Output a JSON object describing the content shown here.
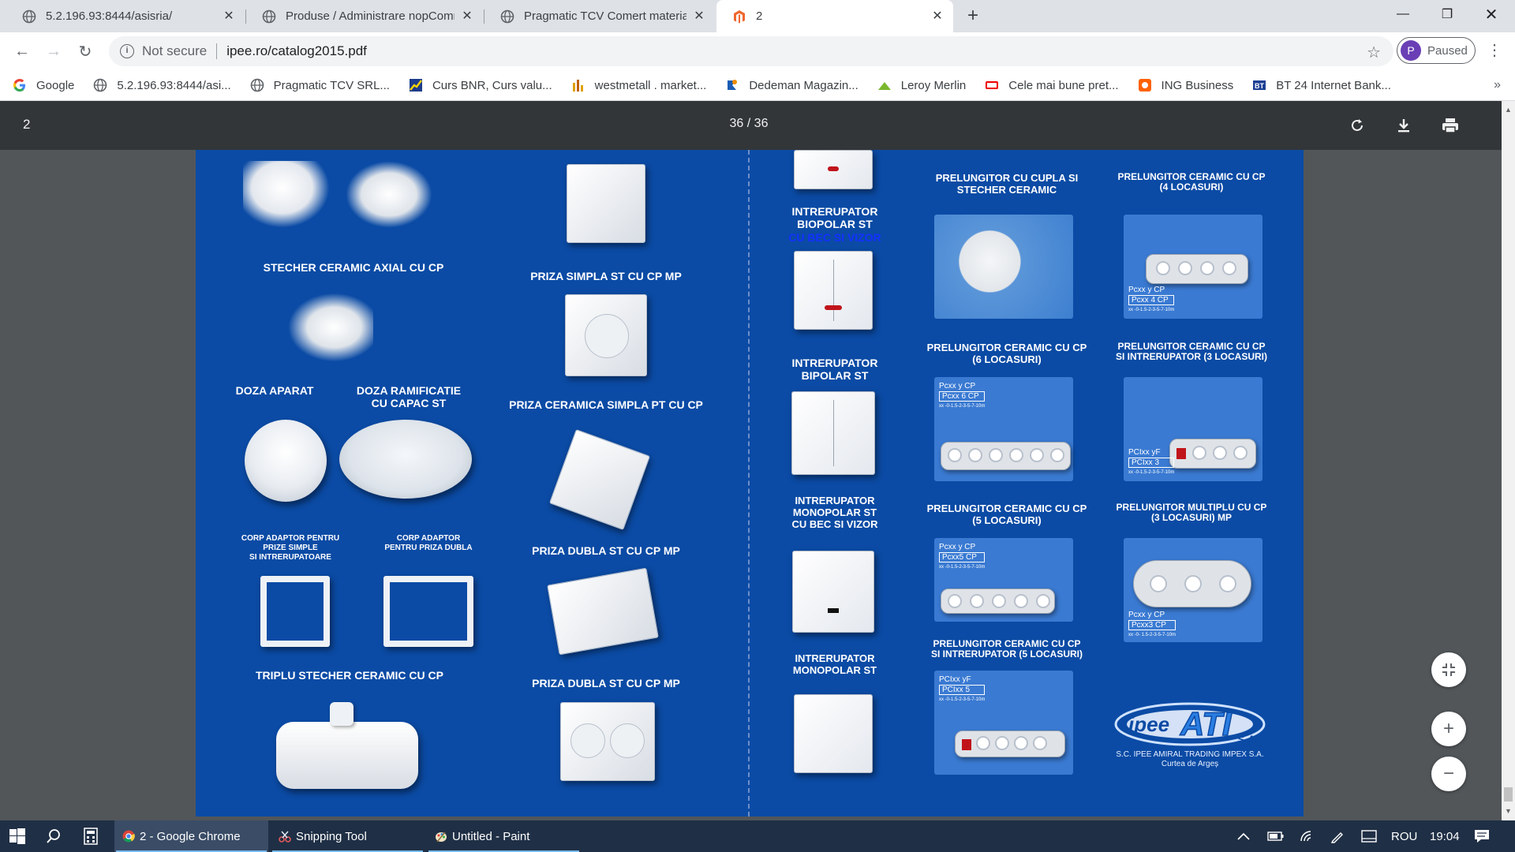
{
  "browser": {
    "tabs": [
      {
        "label": "5.2.196.93:8444/asisria/",
        "icon": "globe-icon"
      },
      {
        "label": "Produse / Administrare nopCommerce",
        "icon": "globe-icon"
      },
      {
        "label": "Pragmatic TCV Comert materiale",
        "icon": "globe-icon"
      },
      {
        "label": "2",
        "icon": "magento-icon"
      }
    ],
    "address": {
      "security": "Not secure",
      "url": "ipee.ro/catalog2015.pdf"
    },
    "profile": {
      "initial": "P",
      "status": "Paused"
    },
    "bookmarks": [
      {
        "label": "Google",
        "icon": "google-icon"
      },
      {
        "label": "5.2.196.93:8444/asi...",
        "icon": "globe-icon"
      },
      {
        "label": "Pragmatic TCV SRL...",
        "icon": "globe-icon"
      },
      {
        "label": "Curs BNR, Curs valu...",
        "icon": "chart-icon"
      },
      {
        "label": "westmetall . market...",
        "icon": "bars-icon"
      },
      {
        "label": "Dedeman Magazin...",
        "icon": "dedeman-icon"
      },
      {
        "label": "Leroy Merlin",
        "icon": "leroy-icon"
      },
      {
        "label": "Cele mai bune pret...",
        "icon": "emag-icon"
      },
      {
        "label": "ING Business",
        "icon": "ing-icon"
      },
      {
        "label": "BT 24 Internet Bank...",
        "icon": "bt-icon"
      }
    ]
  },
  "pdf": {
    "title": "2",
    "page_indicator": "36 / 36",
    "labels": {
      "stecher_axial": "STECHER CERAMIC AXIAL CU CP",
      "doza_aparat": "DOZA APARAT",
      "doza_ramificatie": "DOZA RAMIFICATIE\nCU CAPAC ST",
      "corp_adaptor_simple": "CORP ADAPTOR PENTRU\nPRIZE SIMPLE\nSI INTRERUPATOARE",
      "corp_adaptor_dubla": "CORP ADAPTOR\nPENTRU PRIZA DUBLA",
      "triplu_stecher": "TRIPLU STECHER  CERAMIC CU CP",
      "priza_simpla": "PRIZA  SIMPLA ST CU CP   MP",
      "priza_ceramica": "PRIZA CERAMICA SIMPLA PT CU CP",
      "priza_dubla_1": "PRIZA  DUBLA ST CU CP   MP",
      "priza_dubla_2": "PRIZA  DUBLA ST CU CP   MP",
      "intr_biopolar": "INTRERUPATOR\nBIOPOLAR ST",
      "intr_biopolar_sub": "CU BEC SI VIZOR",
      "intr_bipolar": "INTRERUPATOR\nBIPOLAR ST",
      "intr_monopolar_bec": "INTRERUPATOR\nMONOPOLAR ST\nCU BEC SI VIZOR",
      "intr_monopolar": "INTRERUPATOR\nMONOPOLAR ST",
      "prel_cupla": "PRELUNGITOR CU CUPLA SI\nSTECHER CERAMIC",
      "prel_4": "PRELUNGITOR CERAMIC CU CP\n(4 LOCASURI)",
      "prel_6": "PRELUNGITOR CERAMIC CU CP\n(6 LOCASURI)",
      "prel_3_intr": "PRELUNGITOR CERAMIC CU CP\nSI INTRERUPATOR (3  LOCASURI)",
      "prel_5": "PRELUNGITOR CERAMIC CU CP\n(5 LOCASURI)",
      "prel_multiplu": "PRELUNGITOR MULTIPLU CU CP\n(3 LOCASURI) MP",
      "prel_5_intr": "PRELUNGITOR CERAMIC CU CP\nSI INTRERUPATOR (5  LOCASURI)",
      "company": "S.C. IPEE AMIRAL TRADING IMPEX S.A.\nCurtea de Argeș",
      "logo_text": "ipee ATI S.A."
    },
    "tags": {
      "t4": [
        "Pcxx y CP",
        "Pcxx 4 CP",
        "xx -0-1.5-2-3-5-7-10m"
      ],
      "t6": [
        "Pcxx y CP",
        "Pcxx 6 CP",
        "xx -0-1.5-2-3-5-7-10m"
      ],
      "t3i": [
        "PCIxx yF",
        "PCIxx 3",
        "xx -0-1.5-2-3-5-7-10m"
      ],
      "t5": [
        "Pcxx y CP",
        "Pcxx5 CP",
        "xx -0-1.5-2-3-5-7-10m"
      ],
      "t3m": [
        "Pcxx y CP",
        "Pcxx3 CP",
        "xx -0- 1.5-2-3-5-7-10m"
      ],
      "t5i": [
        "PCIxx yF",
        "PCIxx 5",
        "xx -0-1.5-2-3-5-7-10m"
      ]
    }
  },
  "taskbar": {
    "apps": [
      {
        "label": "2 - Google Chrome",
        "icon": "chrome-icon"
      },
      {
        "label": "Snipping Tool",
        "icon": "snipping-tool-icon"
      },
      {
        "label": "Untitled - Paint",
        "icon": "paint-icon"
      }
    ],
    "language": "ROU",
    "time": "19:04"
  },
  "colors": {
    "catalog_bg": "#0b4ba5",
    "pdf_toolbar": "#323639",
    "taskbar": "#1f2f45"
  }
}
